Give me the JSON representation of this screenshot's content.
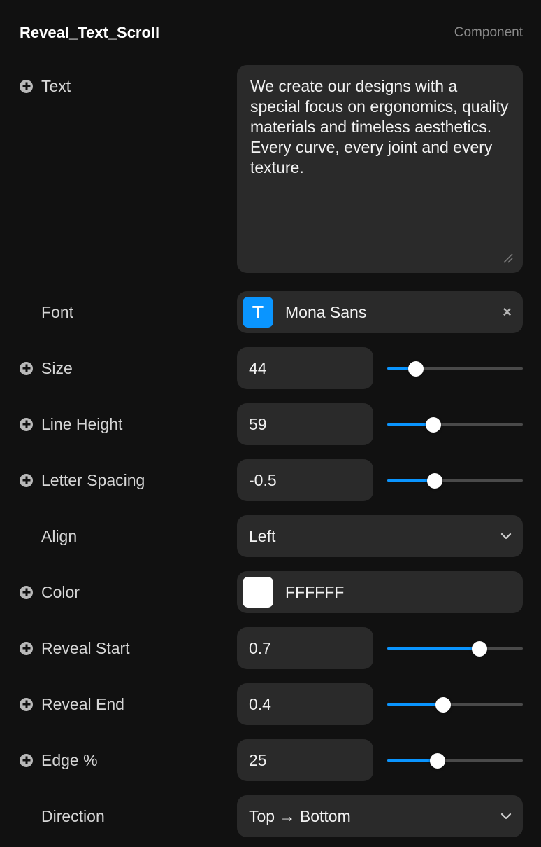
{
  "header": {
    "title": "Reveal_Text_Scroll",
    "tag": "Component"
  },
  "text_prop": {
    "label": "Text",
    "value": "We create our designs with a special focus on ergonomics, quality materials and timeless aesthetics. Every curve, every joint and every texture."
  },
  "font_prop": {
    "label": "Font",
    "badge": "T",
    "value": "Mona Sans",
    "clear": "×"
  },
  "size_prop": {
    "label": "Size",
    "value": "44",
    "slider_fraction": 0.21
  },
  "line_height_prop": {
    "label": "Line Height",
    "value": "59",
    "slider_fraction": 0.34
  },
  "letter_spacing_prop": {
    "label": "Letter Spacing",
    "value": "-0.5",
    "slider_fraction": 0.35
  },
  "align_prop": {
    "label": "Align",
    "value": "Left"
  },
  "color_prop": {
    "label": "Color",
    "value": "FFFFFF",
    "swatch": "#FFFFFF"
  },
  "reveal_start_prop": {
    "label": "Reveal Start",
    "value": "0.7",
    "slider_fraction": 0.68
  },
  "reveal_end_prop": {
    "label": "Reveal End",
    "value": "0.4",
    "slider_fraction": 0.41
  },
  "edge_prop": {
    "label": "Edge %",
    "value": "25",
    "slider_fraction": 0.37
  },
  "direction_prop": {
    "label": "Direction",
    "value": "Top → Bottom"
  },
  "colors": {
    "background": "#111111",
    "field": "#2A2A2A",
    "accent": "#0A95FF"
  }
}
